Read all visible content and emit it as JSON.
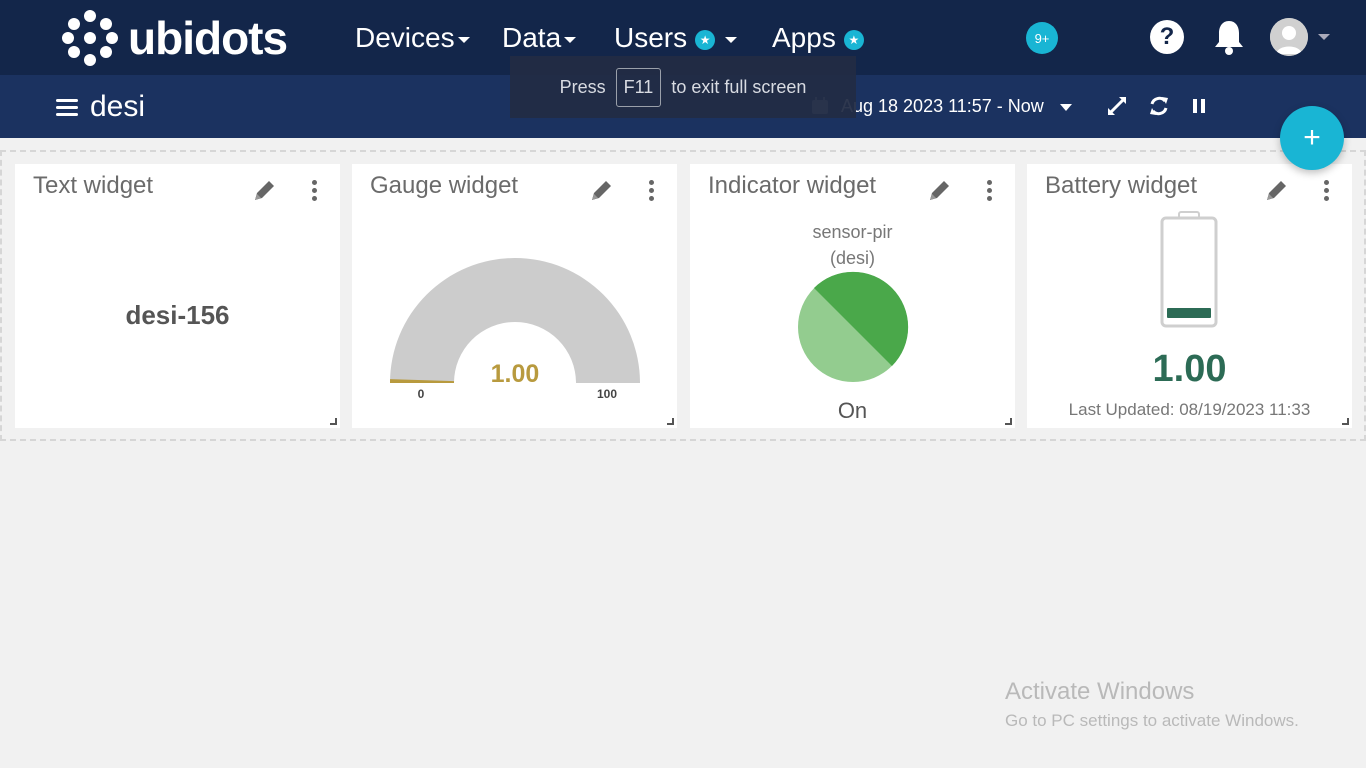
{
  "brand": {
    "name": "ubidots",
    "accent": "#19b5d4",
    "nav_bg": "#13264a"
  },
  "nav": {
    "devices": "Devices",
    "data": "Data",
    "users": "Users",
    "apps": "Apps",
    "notification_count": "9+",
    "help_glyph": "?"
  },
  "fullscreen_toast": {
    "prefix": "Press",
    "key": "F11",
    "suffix": "to exit full screen"
  },
  "dashboard": {
    "name": "desi",
    "date_range": "Aug 18 2023 11:57 - Now",
    "add_glyph": "+"
  },
  "widgets": [
    {
      "title": "Text widget",
      "value": "desi-156"
    },
    {
      "title": "Gauge widget",
      "value": "1.00",
      "min": "0",
      "max": "100",
      "fraction": 0.01,
      "value_color": "#b89a3e"
    },
    {
      "title": "Indicator widget",
      "variable": "sensor-pir",
      "device": "(desi)",
      "state": "On",
      "on_color": "#4aa84a"
    },
    {
      "title": "Battery widget",
      "value": "1.00",
      "last_updated": "Last Updated: 08/19/2023 11:33",
      "level": 0.01,
      "color": "#2c6b55"
    }
  ],
  "watermark": {
    "title": "Activate Windows",
    "subtitle": "Go to PC settings to activate Windows."
  }
}
